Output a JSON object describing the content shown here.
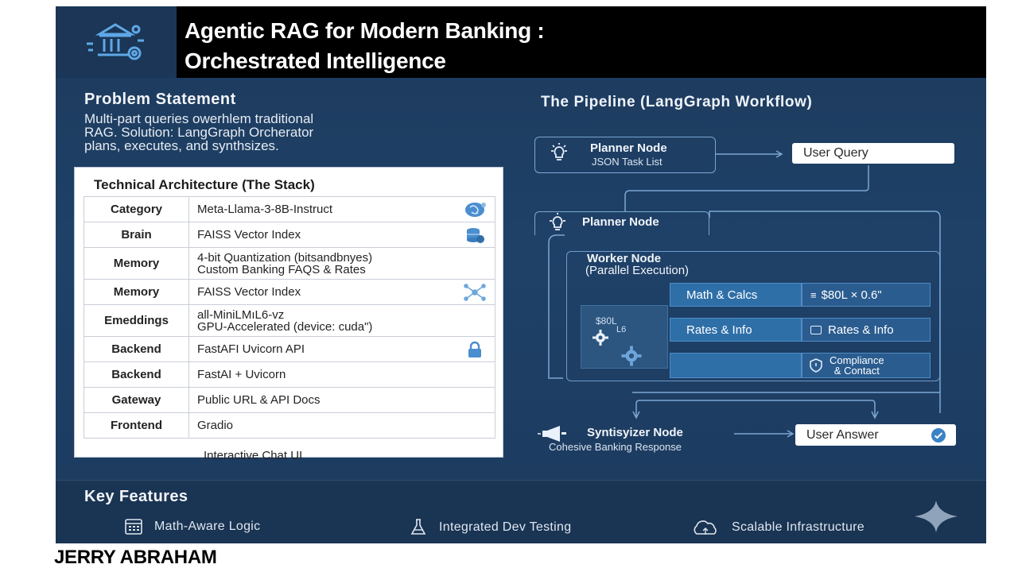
{
  "header": {
    "title_line1": "Agentic RAG for Modern Banking :",
    "title_line2": "Orchestrated Intelligence",
    "logo_icon": "bank-gear-icon"
  },
  "problem": {
    "title": "Problem Statement",
    "line1": "Multi-part queries owerhlem traditional",
    "line2": "RAG. Solution: LangGraph Orcherator",
    "line3": "plans, executes, and synthsizes."
  },
  "architecture": {
    "title": "Technical Architecture (The Stack)",
    "rows": [
      {
        "category": "Category",
        "line1": "Meta-Llama-3-8B-Instruct",
        "line2": "",
        "icon": "brain-icon"
      },
      {
        "category": "Brain",
        "line1": "FAISS Vector Index",
        "line2": "",
        "icon": "database-icon"
      },
      {
        "category": "Memory",
        "line1": "4-bit Quantization (bitsandbnyes)",
        "line2": "Custom Banking FAQS & Rates",
        "icon": ""
      },
      {
        "category": "Memory",
        "line1": "FAISS Vector Index",
        "line2": "",
        "icon": "network-icon"
      },
      {
        "category": "Emeddings",
        "line1": "all-MiniLMıL6-vz",
        "line2": "GPU-Accelerated (device: cuda\")",
        "icon": ""
      },
      {
        "category": "Backend",
        "line1": "FastAFI Uvicorn API",
        "line2": "",
        "icon": "lock-icon"
      },
      {
        "category": "Backend",
        "line1": "FastAI + Uvicorn",
        "line2": "",
        "icon": ""
      },
      {
        "category": "Gateway",
        "line1": "Public URL & API Docs",
        "line2": "",
        "icon": ""
      },
      {
        "category": "Frontend",
        "line1": "Gradio",
        "line2": "",
        "icon": ""
      }
    ],
    "footer": "Interactive Chat UI"
  },
  "pipeline": {
    "title": "The Pipeline (LangGraph Workflow)",
    "planner1": {
      "title": "Planner Node",
      "sub": "JSON Task List"
    },
    "user_query": "User Query",
    "planner2": {
      "title": "Planner Node"
    },
    "worker": {
      "title": "Worker Node",
      "sub": "(Parallel Execution)"
    },
    "worker_icon_text1": "$80L",
    "worker_icon_text2": "L6",
    "tasks": [
      {
        "label": "Math & Calcs",
        "result": "$80L × 0.6\""
      },
      {
        "label": "Rates & Info",
        "result": "Rates & Info"
      },
      {
        "label": "",
        "result_line1": "Compliance",
        "result_line2": "& Contact"
      }
    ],
    "synth": {
      "title": "Syntisyizer Node",
      "sub": "Cohesive Banking Response"
    },
    "user_answer": "User Answer"
  },
  "features": {
    "title": "Key Features",
    "items": [
      {
        "label": "Math-Aware Logic",
        "icon": "calculator-icon"
      },
      {
        "label": "Integrated Dev Testing",
        "icon": "flask-icon"
      },
      {
        "label": "Scalable Infrastructure",
        "icon": "cloud-icon"
      }
    ]
  },
  "author": "JERRY ABRAHAM",
  "colors": {
    "background": "#1f4168",
    "title_bar": "#000000",
    "accent": "#2f6fa8",
    "line": "#7aa7d4"
  }
}
